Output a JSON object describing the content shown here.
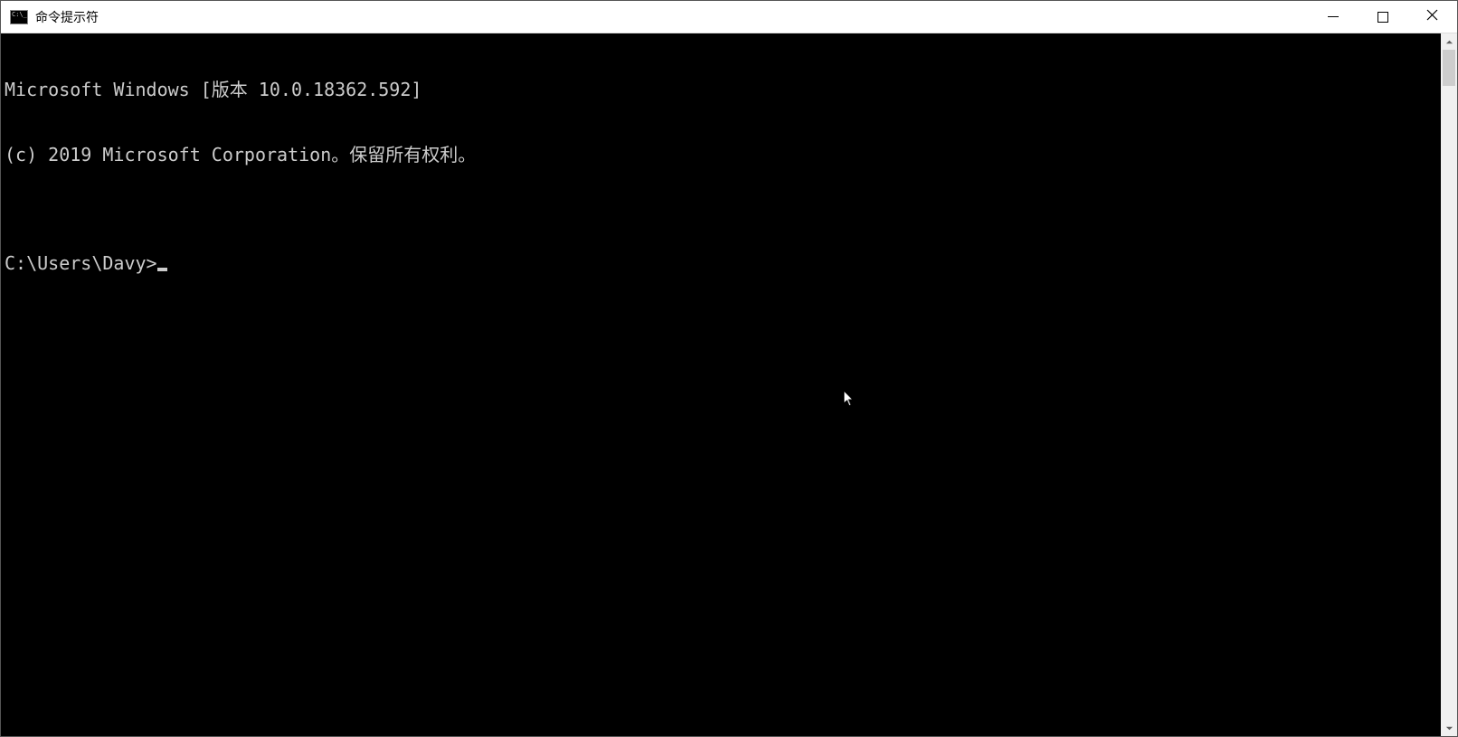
{
  "window": {
    "title": "命令提示符"
  },
  "terminal": {
    "line1": "Microsoft Windows [版本 10.0.18362.592]",
    "line2": "(c) 2019 Microsoft Corporation。保留所有权利。",
    "blank": "",
    "prompt": "C:\\Users\\Davy>"
  }
}
